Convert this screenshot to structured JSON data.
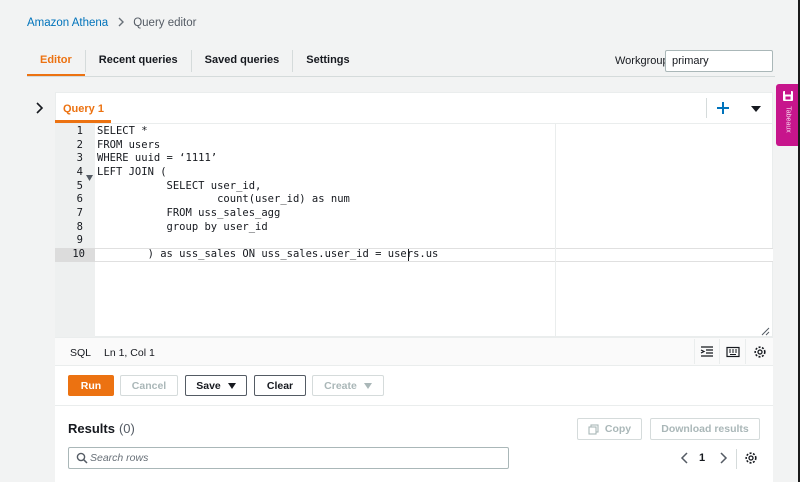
{
  "breadcrumb": {
    "root": "Amazon Athena",
    "current": "Query editor"
  },
  "tabs": [
    {
      "label": "Editor",
      "active": true
    },
    {
      "label": "Recent queries",
      "active": false
    },
    {
      "label": "Saved queries",
      "active": false
    },
    {
      "label": "Settings",
      "active": false
    }
  ],
  "workgroup": {
    "label": "Workgroup",
    "value": "primary"
  },
  "editor": {
    "query_tab": "Query 1",
    "lines": [
      {
        "num": "1",
        "text": "SELECT *"
      },
      {
        "num": "2",
        "text": "FROM users"
      },
      {
        "num": "3",
        "text": "WHERE uuid = ‘1111’"
      },
      {
        "num": "4",
        "text": "LEFT JOIN ("
      },
      {
        "num": "5",
        "text": "           SELECT user_id,"
      },
      {
        "num": "6",
        "text": "                   count(user_id) as num"
      },
      {
        "num": "7",
        "text": "           FROM uss_sales_agg"
      },
      {
        "num": "8",
        "text": "           group by user_id"
      },
      {
        "num": "9",
        "text": ""
      },
      {
        "num": "10",
        "text": "        ) as uss_sales ON uss_sales.user_id = users.us"
      }
    ],
    "active_line": "10"
  },
  "statusbar": {
    "language": "SQL",
    "position": "Ln 1, Col 1"
  },
  "actions": {
    "run": "Run",
    "cancel": "Cancel",
    "save": "Save",
    "clear": "Clear",
    "create": "Create"
  },
  "results": {
    "title": "Results",
    "count": "(0)",
    "copy": "Copy",
    "download": "Download results",
    "search_placeholder": "Search rows",
    "page": "1"
  },
  "side_widget": {
    "text": "Tabeaux"
  },
  "colors": {
    "accent": "#ec7211",
    "link": "#0073bb",
    "widget": "#c7158c"
  }
}
